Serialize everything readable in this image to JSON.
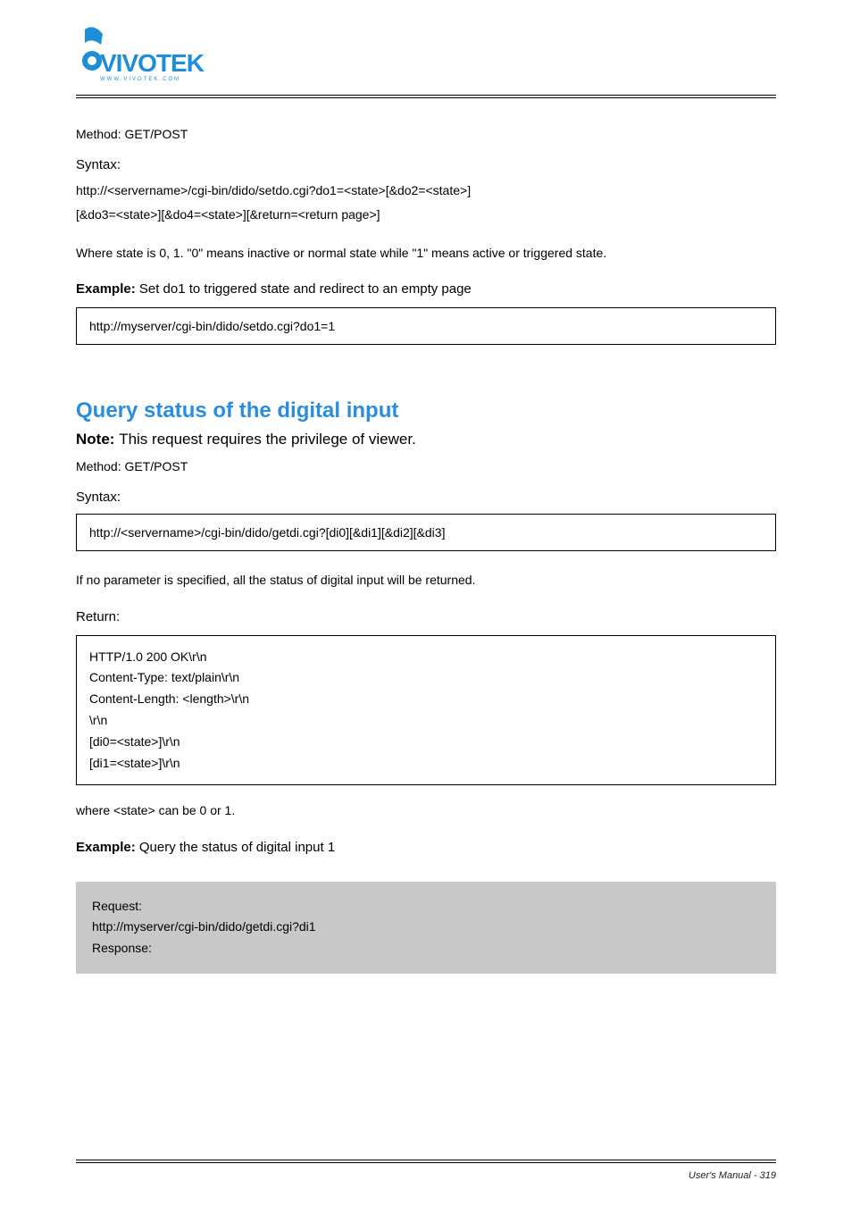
{
  "section1": {
    "method": "Method: GET/POST",
    "syntaxLabel": "Syntax:",
    "syntaxLine1": "http://<servername>/cgi-bin/dido/setdo.cgi?do1=<state>[&do2=<state>]",
    "syntaxLine2": "[&do3=<state>][&do4=<state>][&return=<return page>]",
    "paramText": "Where state is 0, 1. \"0\" means inactive or normal state while \"1\" means active or triggered state.",
    "exampleLabel": "Example:  Set do1 to triggered state and redirect to an empty page",
    "exampleCode": "http://myserver/cgi-bin/dido/setdo.cgi?do1=1"
  },
  "section2": {
    "heading": "Query status of the digital input",
    "noteHeading": "Note:",
    "noteText": "This request requires the privilege of viewer.",
    "method": "Method: GET/POST",
    "syntaxLabel": "Syntax:",
    "syntaxLine": "http://<servername>/cgi-bin/dido/getdi.cgi?[di0][&di1][&di2][&di3]",
    "paramText": "If no parameter is specified, all the status of digital input will be returned.",
    "returnLabel": "Return:",
    "returnLines": [
      "HTTP/1.0 200 OK\\r\\n",
      "Content-Type: text/plain\\r\\n",
      "Content-Length: <length>\\r\\n",
      "\\r\\n",
      "[di0=<state>]\\r\\n",
      "[di1=<state>]\\r\\n"
    ],
    "paramText2": "where <state> can be 0 or 1.",
    "exampleLabel": "Example:  Query the status of digital input 1",
    "grayLines": [
      "Request:",
      "http://myserver/cgi-bin/dido/getdi.cgi?di1",
      "",
      "Response:"
    ]
  },
  "footer": {
    "left": "User's Manual - 319",
    "right": ""
  }
}
